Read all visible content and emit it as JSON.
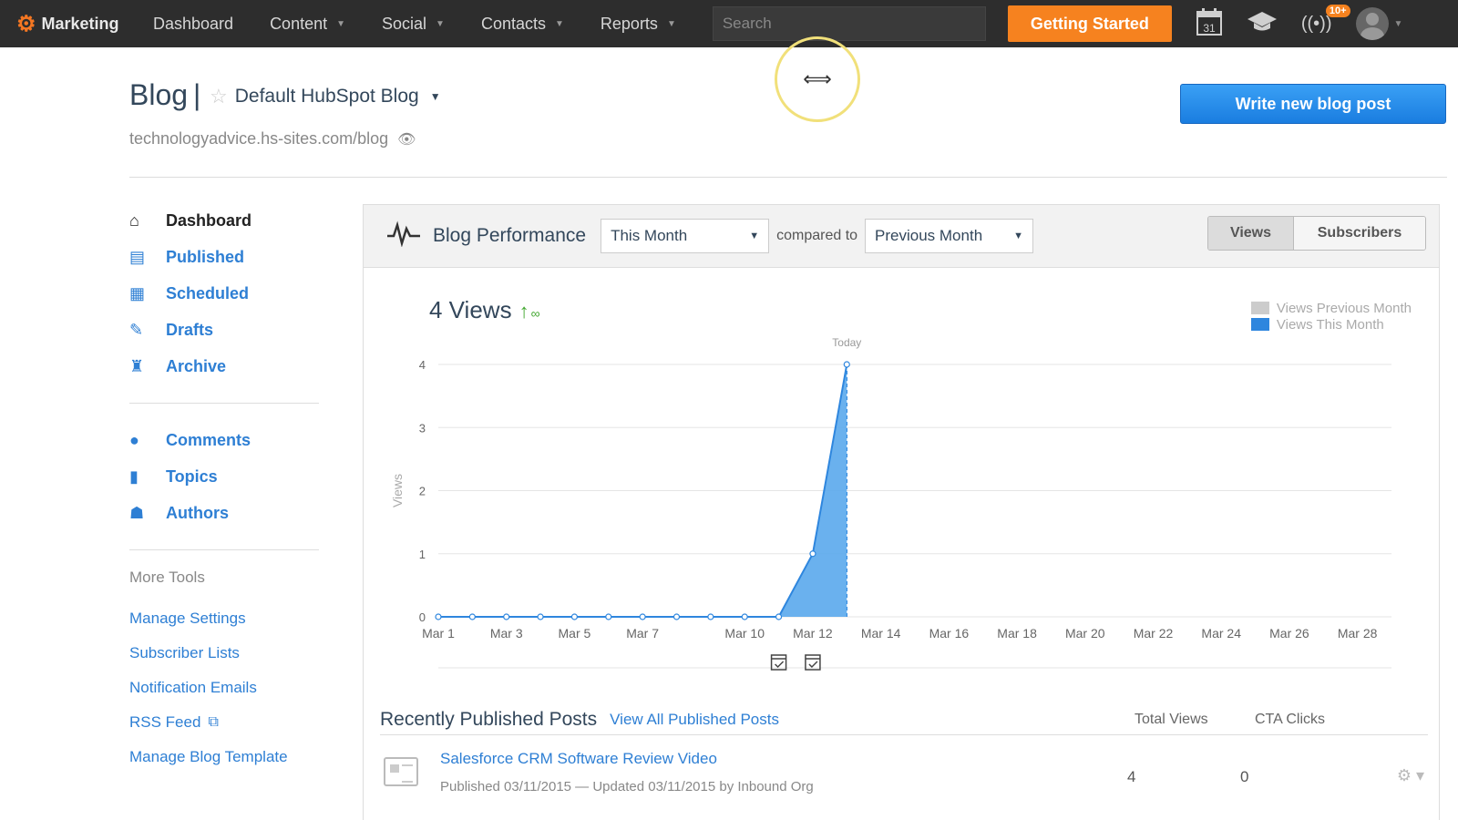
{
  "nav": {
    "brand": "Marketing",
    "items": [
      {
        "label": "Dashboard",
        "caret": false
      },
      {
        "label": "Content",
        "caret": true
      },
      {
        "label": "Social",
        "caret": true
      },
      {
        "label": "Contacts",
        "caret": true
      },
      {
        "label": "Reports",
        "caret": true
      }
    ],
    "search_placeholder": "Search",
    "getting_started": "Getting Started",
    "calendar_day": "31",
    "notifications_badge": "10+"
  },
  "header": {
    "title": "Blog",
    "separator": "|",
    "blog_name": "Default HubSpot Blog",
    "url": "technologyadvice.hs-sites.com/blog",
    "write_button": "Write new blog post"
  },
  "sidebar": {
    "items": [
      {
        "label": "Dashboard",
        "icon": "home-icon",
        "glyph": "⌂",
        "active": true
      },
      {
        "label": "Published",
        "icon": "published-icon",
        "glyph": "▤",
        "active": false
      },
      {
        "label": "Scheduled",
        "icon": "calendar-icon",
        "glyph": "▦",
        "active": false
      },
      {
        "label": "Drafts",
        "icon": "pencil-icon",
        "glyph": "✎",
        "active": false
      },
      {
        "label": "Archive",
        "icon": "archive-icon",
        "glyph": "♜",
        "active": false
      }
    ],
    "items2": [
      {
        "label": "Comments",
        "icon": "comment-icon",
        "glyph": "●"
      },
      {
        "label": "Topics",
        "icon": "bookmark-icon",
        "glyph": "▮"
      },
      {
        "label": "Authors",
        "icon": "user-icon",
        "glyph": "☗"
      }
    ],
    "more_tools_title": "More Tools",
    "more_tools": [
      "Manage Settings",
      "Subscriber Lists",
      "Notification Emails",
      "RSS Feed",
      "Manage Blog Template"
    ]
  },
  "performance": {
    "title": "Blog Performance",
    "period": "This Month",
    "compared_label": "compared to",
    "compare_period": "Previous Month",
    "toggle_views": "Views",
    "toggle_subscribers": "Subscribers",
    "total": "4 Views",
    "trend_symbol": "↑",
    "trend_value": "∞"
  },
  "chart_data": {
    "type": "area",
    "ylabel": "Views",
    "ylim": [
      0,
      4
    ],
    "yticks": [
      0,
      1,
      2,
      3,
      4
    ],
    "x_tick_labels": [
      "Mar 1",
      "Mar 3",
      "Mar 5",
      "Mar 7",
      "Mar 10",
      "Mar 12",
      "Mar 14",
      "Mar 16",
      "Mar 18",
      "Mar 20",
      "Mar 22",
      "Mar 24",
      "Mar 26",
      "Mar 28"
    ],
    "x_range": [
      0,
      28
    ],
    "today_label": "Today",
    "today_day": 12,
    "legend": [
      {
        "name": "Views Previous Month",
        "color": "#cccccc"
      },
      {
        "name": "Views This Month",
        "color": "#2e86de"
      }
    ],
    "series": [
      {
        "name": "Views This Month",
        "x": [
          0,
          1,
          2,
          3,
          4,
          5,
          6,
          7,
          8,
          9,
          10,
          11,
          12
        ],
        "values": [
          0,
          0,
          0,
          0,
          0,
          0,
          0,
          0,
          0,
          0,
          0,
          1,
          4
        ]
      }
    ],
    "event_days": [
      10,
      11
    ]
  },
  "recent": {
    "title": "Recently Published Posts",
    "view_all": "View All Published Posts",
    "col_views": "Total Views",
    "col_cta": "CTA Clicks",
    "posts": [
      {
        "title": "Salesforce CRM Software Review Video",
        "meta": "Published 03/11/2015 — Updated 03/11/2015 by Inbound Org",
        "views": "4",
        "cta": "0"
      }
    ]
  },
  "colors": {
    "accent_orange": "#f6821f",
    "link_blue": "#2e7fd4",
    "series_blue": "#2e86de"
  }
}
